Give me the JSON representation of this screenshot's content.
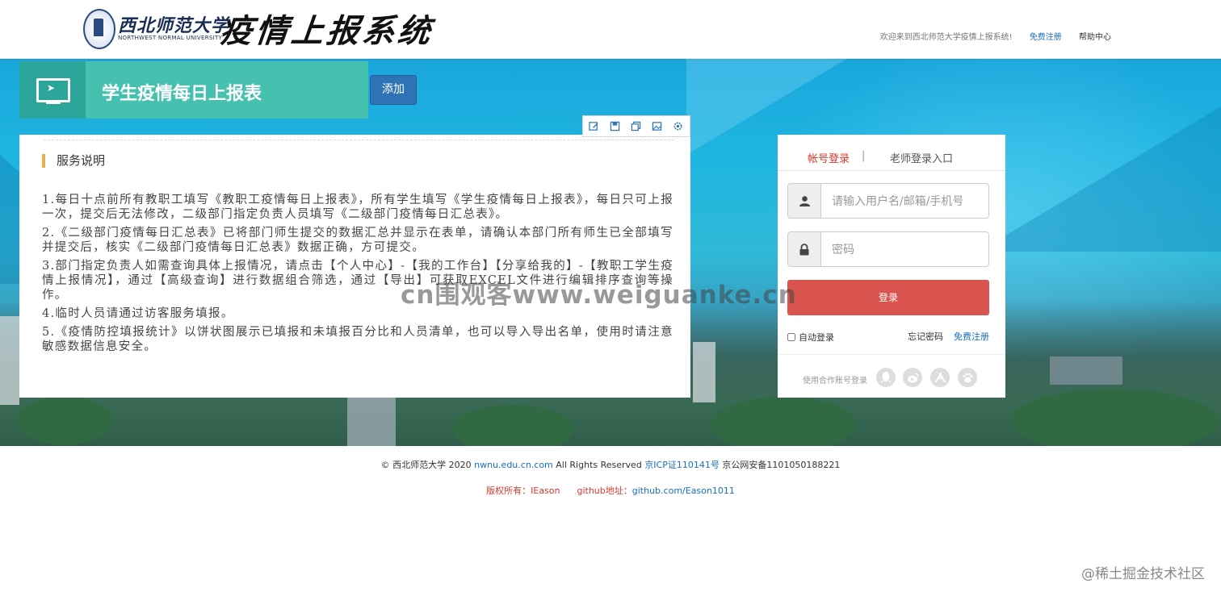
{
  "header": {
    "school_cn": "西北师范大学",
    "school_en": "NORTHWEST NORMAL UNIVERSITY",
    "system_title": "疫情上报系统",
    "welcome": "欢迎来到西北师范大学疫情上报系统!",
    "register": "免费注册",
    "help": "帮助中心"
  },
  "banner": {
    "title": "学生疫情每日上报表",
    "add_button": "添加",
    "icon": "monitor-icon"
  },
  "toolbar": {
    "icons": [
      "edit-icon",
      "save-icon",
      "copy-icon",
      "image-icon",
      "settings-icon"
    ]
  },
  "service": {
    "title": "服务说明",
    "items": [
      "1.每日十点前所有教职工填写《教职工疫情每日上报表》，所有学生填写《学生疫情每日上报表》，每日只可上报一次，提交后无法修改，二级部门指定负责人员填写《二级部门疫情每日汇总表》。",
      "2.《二级部门疫情每日汇总表》已将部门师生提交的数据汇总并显示在表单，请确认本部门所有师生已全部填写并提交后，核实《二级部门疫情每日汇总表》数据正确，方可提交。",
      "3.部门指定负责人如需查询具体上报情况，请点击【个人中心】-【我的工作台】【分享给我的】-【教职工学生疫情上报情况】，通过【高级查询】进行数据组合筛选，通过【导出】可获取EXCEL文件进行编辑排序查询等操作。",
      "4.临时人员请通过访客服务填报。",
      "5.《疫情防控填报统计》以饼状图展示已填报和未填报百分比和人员清单，也可以导入导出名单，使用时请注意敏感数据信息安全。"
    ]
  },
  "login": {
    "tab_account": "帐号登录",
    "tab_separator": "|",
    "tab_teacher": "老师登录入口",
    "username_placeholder": "请输入用户名/邮箱/手机号",
    "username_value": "",
    "password_placeholder": "密码",
    "password_value": "",
    "submit": "登录",
    "auto_login": "自动登录",
    "forgot": "忘记密码",
    "register": "免费注册",
    "social_label": "使用合作账号登录",
    "social_icons": [
      "qq-icon",
      "weibo-icon",
      "renren-icon",
      "baidu-icon"
    ],
    "accent_color": "#d9534f"
  },
  "footer": {
    "copyright": "© 西北师范大学 2020",
    "domain": "nwnu.edu.cn.com",
    "rights": "All Rights Reserved",
    "icp": "京ICP证110141号",
    "police": "京公网安备1101050188221",
    "owner_label": "版权所有：IEason",
    "github_label": "github地址：",
    "github_url": "github.com/Eason1011"
  },
  "overlay": {
    "watermark": "cn围观客www.weiguanke.cn",
    "brand": "@稀土掘金技术社区"
  }
}
